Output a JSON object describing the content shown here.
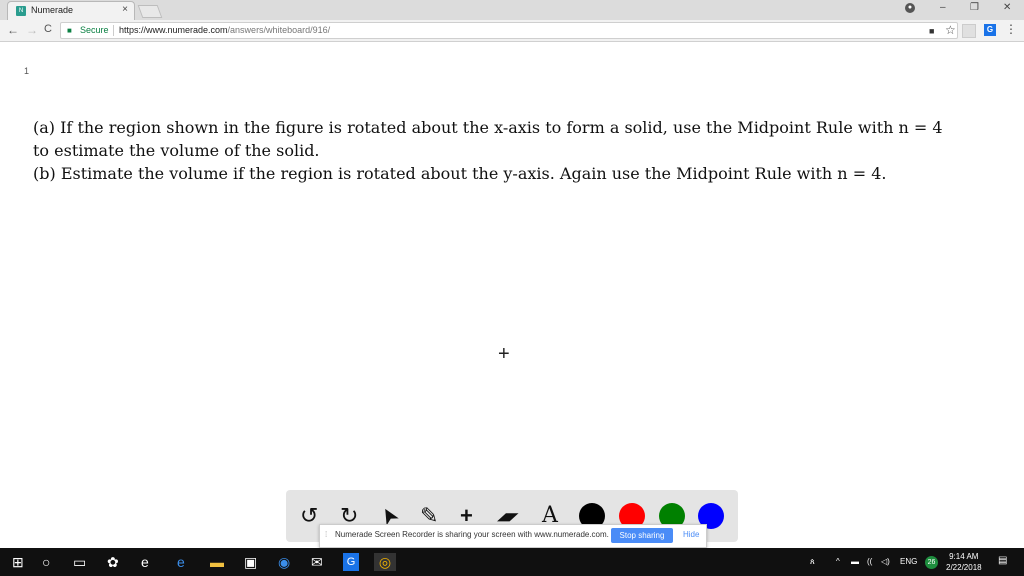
{
  "browser": {
    "tab_title": "Numerade",
    "tab_close": "×",
    "favicon_text": "N",
    "secure_label": "Secure",
    "url_main": "https://www.numerade.com",
    "url_path": "/answers/whiteboard/916/",
    "window_controls": {
      "minimize": "–",
      "restore": "❐",
      "close": "✕"
    },
    "nav": {
      "back": "←",
      "forward": "→",
      "reload": "C"
    },
    "ext_g": "G",
    "menu": "⋮"
  },
  "page": {
    "page_number": "1",
    "problem_lines": [
      "(a) If the region shown in the figure is rotated about the x-axis to form a solid, use the Midpoint Rule with n = 4",
      "to estimate the volume of the solid.",
      "(b) Estimate the volume if the region is rotated about the y-axis. Again use the Midpoint Rule with n = 4."
    ],
    "cursor": "+"
  },
  "whiteboard_toolbar": {
    "tools": [
      {
        "name": "undo-icon",
        "glyph": "↺"
      },
      {
        "name": "redo-icon",
        "glyph": "↻"
      },
      {
        "name": "pointer-icon",
        "glyph": "➤"
      },
      {
        "name": "pen-icon",
        "glyph": "✎"
      },
      {
        "name": "add-icon",
        "glyph": "+"
      },
      {
        "name": "eraser-icon",
        "glyph": "▰"
      },
      {
        "name": "text-icon",
        "glyph": "A"
      }
    ],
    "colors": [
      "#000000",
      "#ff0000",
      "#008000",
      "#0000ff"
    ]
  },
  "sharing_bar": {
    "message": "Numerade Screen Recorder is sharing your screen with www.numerade.com.",
    "stop_label": "Stop sharing",
    "hide_label": "Hide"
  },
  "taskbar": {
    "tray_lang": "ENG",
    "badge": "26",
    "time": "9:14 AM",
    "date": "2/22/2018"
  }
}
